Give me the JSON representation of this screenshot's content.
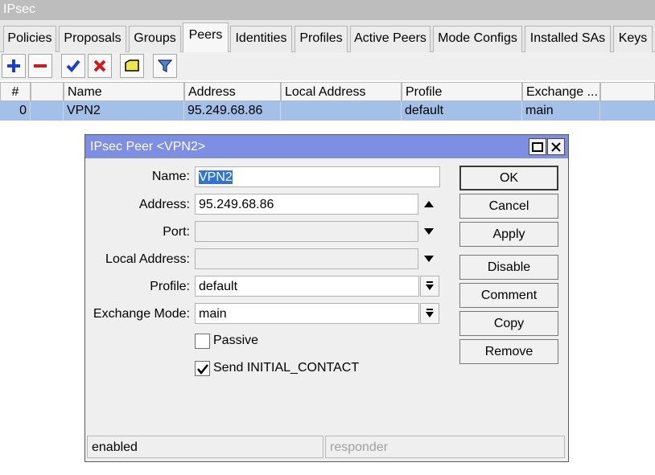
{
  "window": {
    "title": "IPsec"
  },
  "tabs": [
    "Policies",
    "Proposals",
    "Groups",
    "Peers",
    "Identities",
    "Profiles",
    "Active Peers",
    "Mode Configs",
    "Installed SAs",
    "Keys"
  ],
  "active_tab": "Peers",
  "toolbar": {
    "icons": [
      "plus-icon",
      "minus-icon",
      "check-icon",
      "cross-icon",
      "comment-icon",
      "filter-icon"
    ],
    "colors": {
      "add": "#1a3fd0",
      "remove": "#cc1c1c",
      "enable": "#1a3fd0",
      "disable": "#cc1c1c",
      "comment": "#ece64a",
      "filter": "#4a86d4"
    }
  },
  "table": {
    "columns": [
      "#",
      "",
      "Name",
      "Address",
      "Local Address",
      "Profile",
      "Exchange ..."
    ],
    "rows": [
      {
        "num": "0",
        "flag": "",
        "name": "VPN2",
        "address": "95.249.68.86",
        "local_address": "",
        "profile": "default",
        "exchange": "main"
      }
    ]
  },
  "dialog": {
    "title": "IPsec Peer <VPN2>",
    "fields": {
      "name": {
        "label": "Name:",
        "value": "VPN2"
      },
      "address": {
        "label": "Address:",
        "value": "95.249.68.86"
      },
      "port": {
        "label": "Port:",
        "value": ""
      },
      "local_address": {
        "label": "Local Address:",
        "value": ""
      },
      "profile": {
        "label": "Profile:",
        "value": "default"
      },
      "exchange_mode": {
        "label": "Exchange Mode:",
        "value": "main"
      }
    },
    "passive": {
      "label": "Passive",
      "checked": false
    },
    "initial_contact": {
      "label": "Send INITIAL_CONTACT",
      "checked": true
    },
    "buttons": {
      "ok": "OK",
      "cancel": "Cancel",
      "apply": "Apply",
      "disable": "Disable",
      "comment": "Comment",
      "copy": "Copy",
      "remove": "Remove"
    },
    "status": {
      "left": "enabled",
      "right": "responder"
    }
  }
}
